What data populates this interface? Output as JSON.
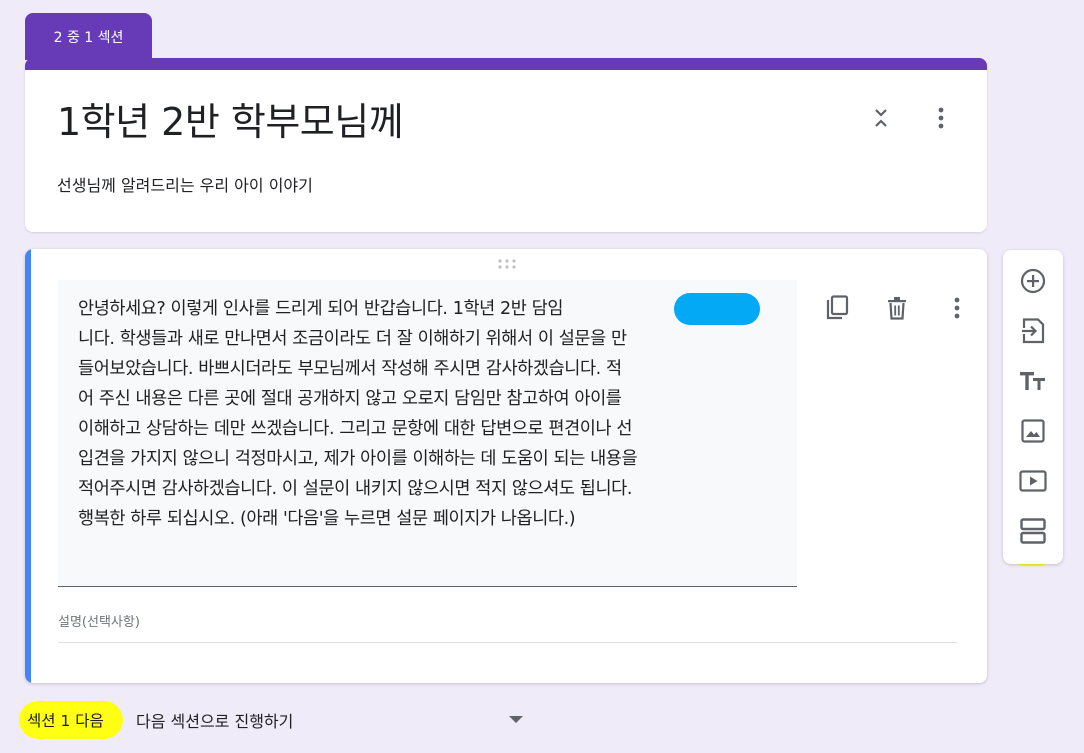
{
  "section_tab": {
    "label": "2 중 1 섹션"
  },
  "header": {
    "title": "1학년 2반 학부모님께",
    "subtitle": "선생님께 알려드리는 우리 아이 이야기",
    "collapse_icon": "collapse-icon",
    "more_icon": "more-vert-icon"
  },
  "description_item": {
    "body": "안녕하세요? 이렇게 인사를 드리게 되어 반갑습니다. 1학년 2반 담임\n니다. 학생들과 새로 만나면서 조금이라도 더 잘 이해하기 위해서 이 설문을 만\n들어보았습니다. 바쁘시더라도 부모님께서 작성해 주시면 감사하겠습니다. 적\n어 주신 내용은 다른 곳에 절대 공개하지 않고 오로지 담임만 참고하여 아이를\n이해하고 상담하는 데만 쓰겠습니다. 그리고 문항에 대한 답변으로 편견이나 선\n입견을 가지지 않으니 걱정마시고, 제가 아이를 이해하는 데 도움이 되는 내용을\n적어주시면 감사하겠습니다. 이 설문이 내키지 않으시면 적지 않으셔도 됩니다.\n행복한 하루 되십시오. (아래 '다음'을 누르면 설문 페이지가 나옵니다.)",
    "description_label": "설명(선택사항)",
    "accent_color": "#4285f4",
    "redaction_color": "#03a9f4"
  },
  "side_toolbar": {
    "items": [
      {
        "name": "add-question",
        "icon": "add-circle-icon"
      },
      {
        "name": "import-questions",
        "icon": "import-icon"
      },
      {
        "name": "add-title",
        "icon": "title-text-icon",
        "highlighted": true
      },
      {
        "name": "add-image",
        "icon": "image-icon"
      },
      {
        "name": "add-video",
        "icon": "video-icon"
      },
      {
        "name": "add-section",
        "icon": "section-icon",
        "highlighted": true
      }
    ],
    "highlight_color": "#ffff14"
  },
  "footer": {
    "after_section_label": "섹션 1 다음",
    "next_action": "다음 섹션으로 진행하기"
  },
  "colors": {
    "background": "#f0ebf8",
    "primary": "#673ab7"
  }
}
